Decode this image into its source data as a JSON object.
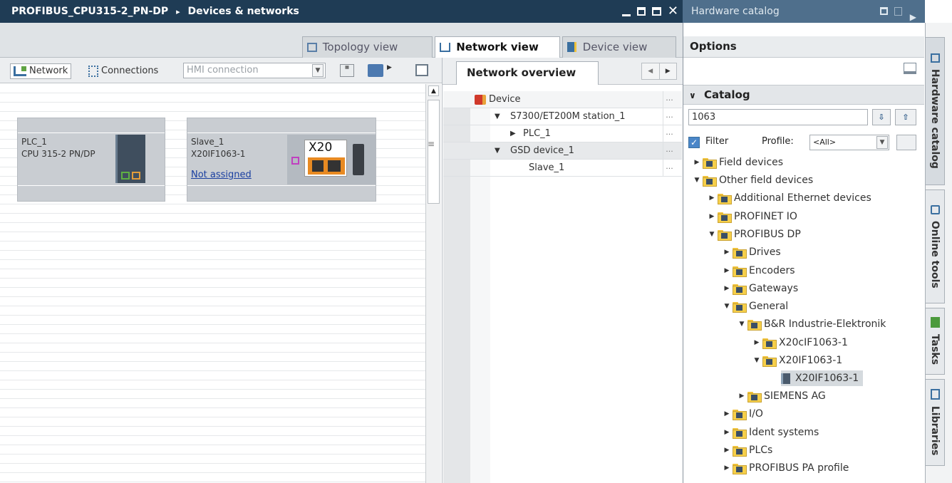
{
  "editor": {
    "title_project": "PROFIBUS_CPU315-2_PN-DP",
    "title_separator": "▸",
    "title_page": "Devices & networks",
    "views": {
      "topology": "Topology view",
      "network": "Network view",
      "device": "Device view"
    },
    "toolbar": {
      "network": "Network",
      "connections": "Connections",
      "connection_type": "HMI connection"
    },
    "devices": [
      {
        "name": "PLC_1",
        "type": "CPU 315-2 PN/DP"
      },
      {
        "name": "Slave_1",
        "type": "X20IF1063-1",
        "status": "Not assigned",
        "module_label": "X20"
      }
    ]
  },
  "overview": {
    "tab": "Network overview",
    "header": "Device",
    "rows": [
      {
        "label": "S7300/ET200M station_1",
        "expander": "▼"
      },
      {
        "label": "PLC_1",
        "expander": "▶"
      },
      {
        "label": "GSD device_1",
        "expander": "▼"
      },
      {
        "label": "Slave_1",
        "expander": ""
      }
    ],
    "dots": "..."
  },
  "catalog_panel": {
    "title": "Hardware catalog",
    "options": "Options",
    "catalog_header": "Catalog",
    "search_value": "1063",
    "filter_label": "Filter",
    "profile_label": "Profile:",
    "profile_value": "<All>",
    "tree": [
      {
        "label": "Field devices",
        "expander": "▶"
      },
      {
        "label": "Other field devices",
        "expander": "▼"
      },
      {
        "label": "Additional Ethernet devices",
        "expander": "▶"
      },
      {
        "label": "PROFINET IO",
        "expander": "▶"
      },
      {
        "label": "PROFIBUS DP",
        "expander": "▼"
      },
      {
        "label": "Drives",
        "expander": "▶"
      },
      {
        "label": "Encoders",
        "expander": "▶"
      },
      {
        "label": "Gateways",
        "expander": "▶"
      },
      {
        "label": "General",
        "expander": "▼"
      },
      {
        "label": "B&R Industrie-Elektronik",
        "expander": "▼"
      },
      {
        "label": "X20cIF1063-1",
        "expander": "▶"
      },
      {
        "label": "X20IF1063-1",
        "expander": "▼"
      },
      {
        "label": "X20IF1063-1",
        "expander": ""
      },
      {
        "label": "SIEMENS AG",
        "expander": "▶"
      },
      {
        "label": "I/O",
        "expander": "▶"
      },
      {
        "label": "Ident systems",
        "expander": "▶"
      },
      {
        "label": "PLCs",
        "expander": "▶"
      },
      {
        "label": "PROFIBUS PA profile",
        "expander": "▶"
      }
    ]
  },
  "side_tabs": [
    "Hardware catalog",
    "Online tools",
    "Tasks",
    "Libraries"
  ]
}
